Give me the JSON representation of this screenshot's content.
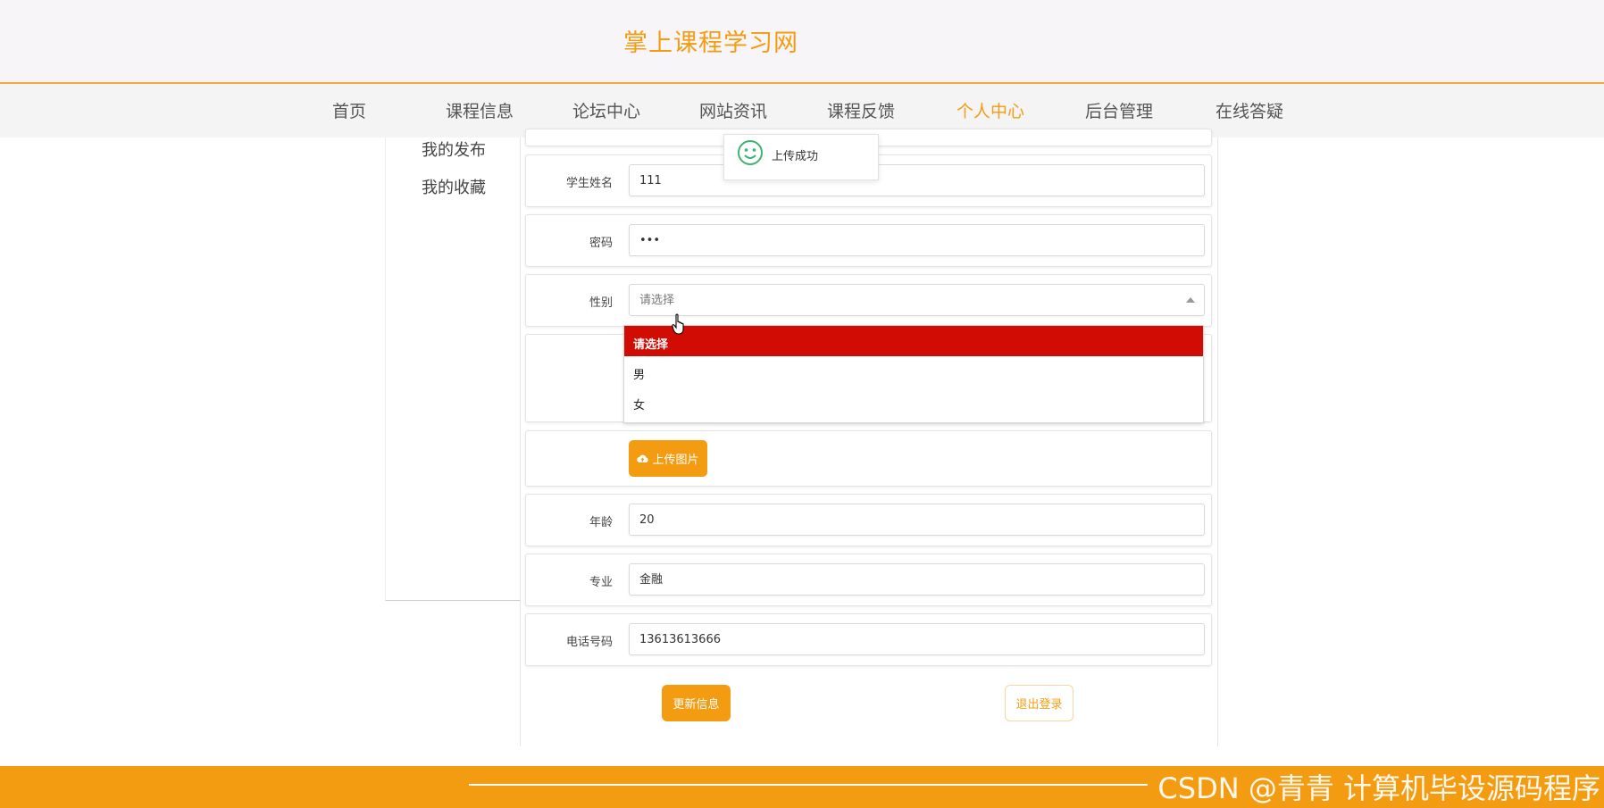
{
  "header": {
    "site_title": "掌上课程学习网"
  },
  "nav": {
    "items": [
      {
        "label": "首页"
      },
      {
        "label": "课程信息"
      },
      {
        "label": "论坛中心"
      },
      {
        "label": "网站资讯"
      },
      {
        "label": "课程反馈"
      },
      {
        "label": "个人中心",
        "active": true
      },
      {
        "label": "后台管理"
      },
      {
        "label": "在线答疑"
      }
    ]
  },
  "sidebar": {
    "items": [
      {
        "label": "我的发布"
      },
      {
        "label": "我的收藏"
      }
    ]
  },
  "toast": {
    "message": "上传成功"
  },
  "form": {
    "name": {
      "label": "学生姓名",
      "value": "111"
    },
    "password": {
      "label": "密码",
      "value": "•••"
    },
    "gender": {
      "label": "性别",
      "placeholder": "请选择",
      "options": [
        "请选择",
        "男",
        "女"
      ],
      "highlighted": "请选择"
    },
    "upload_label": "上传图片",
    "age": {
      "label": "年龄",
      "value": "20"
    },
    "major": {
      "label": "专业",
      "value": "金融"
    },
    "phone": {
      "label": "电话号码",
      "value": "13613613666"
    },
    "update_label": "更新信息",
    "logout_label": "退出登录"
  },
  "footer": {
    "watermark": "CSDN @青青  计算机毕设源码程序"
  },
  "colors": {
    "accent": "#f39c12",
    "highlight": "#d10c04",
    "toast_icon": "#3cb371"
  }
}
